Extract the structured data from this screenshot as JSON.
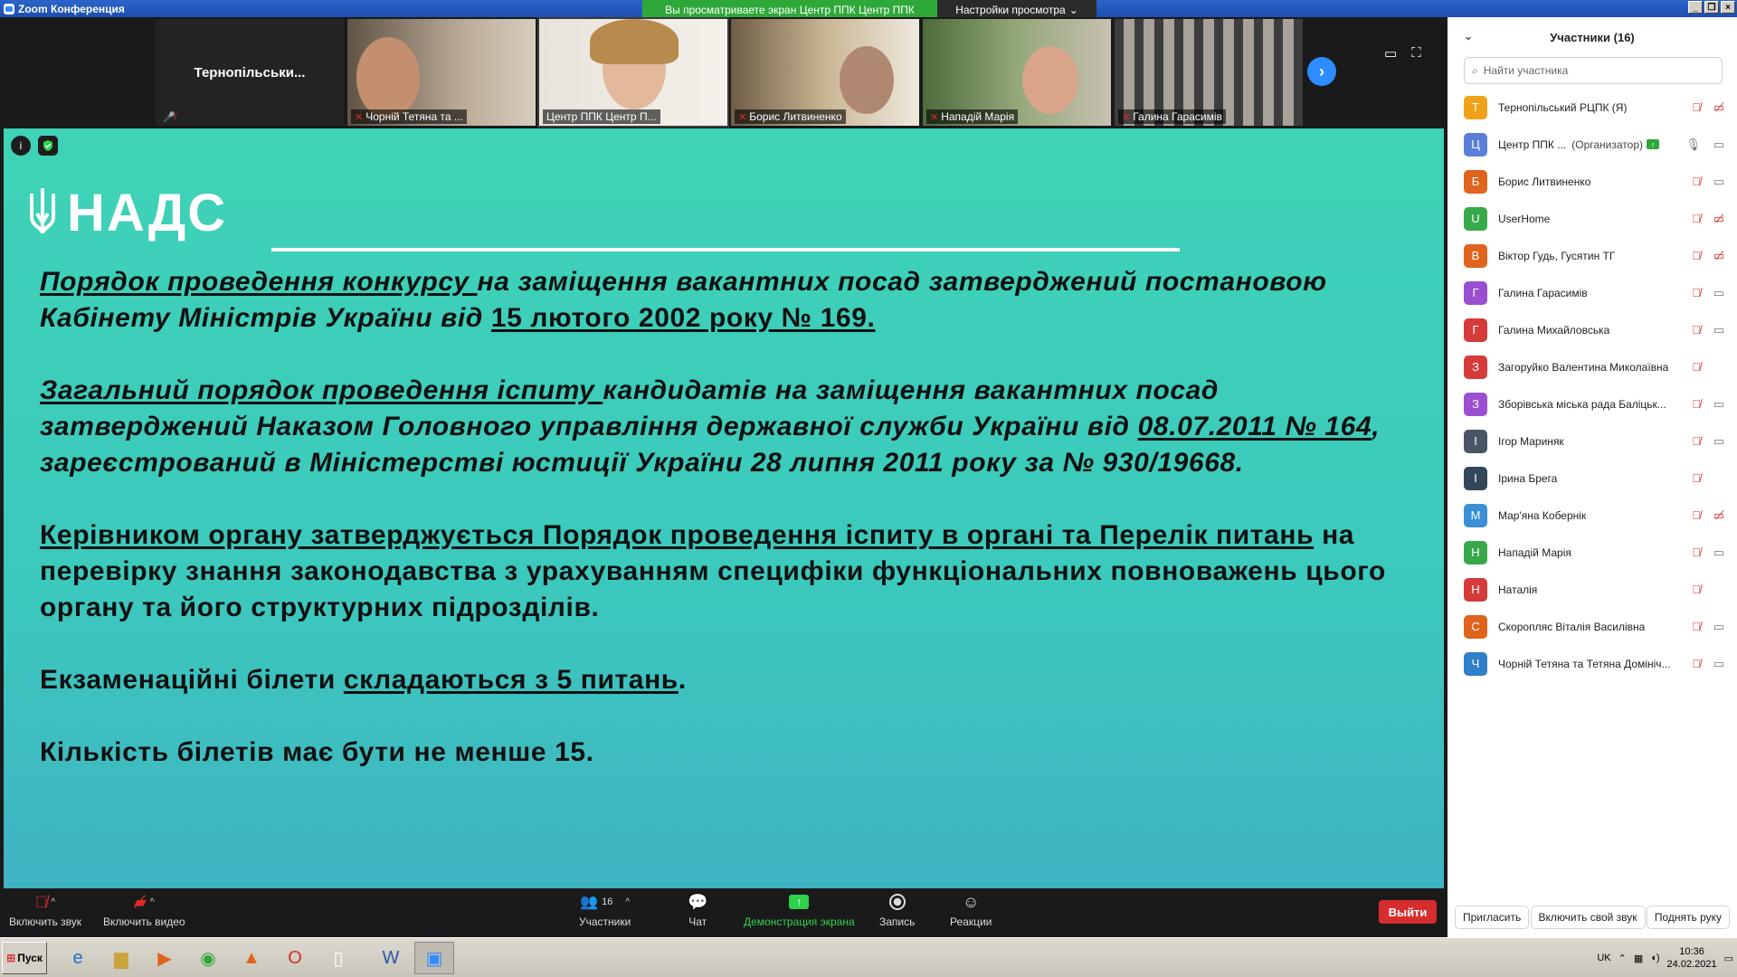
{
  "window": {
    "title": "Zoom Конференция",
    "viewing_banner": "Вы просматриваете экран Центр ППК Центр ППК",
    "view_settings": "Настройки просмотра"
  },
  "tiles": [
    {
      "name": "Тернопільськи..."
    },
    {
      "name": "Чорній Тетяна та ..."
    },
    {
      "name": "Центр ППК Центр П..."
    },
    {
      "name": "Борис Литвиненко"
    },
    {
      "name": "Нападій Марія"
    },
    {
      "name": "Галина Гарасимів"
    }
  ],
  "slide": {
    "logo": "НАДС",
    "p1_u1": "Порядок проведення конкурсу ",
    "p1_t1": "на заміщення вакантних посад затверджений постановою Кабінету Міністрів України від ",
    "p1_u2": "15 лютого 2002 року № 169.",
    "p2_u1": "Загальний порядок проведення іспиту ",
    "p2_t1": "кандидатів на заміщення вакантних посад затверджений Наказом Головного управління державної служби України від ",
    "p2_u2": "08.07.2011 № 164",
    "p2_t2": ", зареєстрований в Міністерстві юстиції України 28 липня 2011 року за № 930/19668.",
    "p3_u1": "Керівником органу затверджується Порядок проведення іспиту в органі та Перелік питань",
    "p3_t1": " на перевірку знання законодавства з урахуванням специфіки функціональних повноважень цього органу та його структурних підрозділів.",
    "p4_t1": "Екзаменаційні білети ",
    "p4_u1": "складаються з 5 питань",
    "p4_t2": ".",
    "p5_t1": "Кількість білетів має бути не менше 15."
  },
  "toolbar": {
    "audio": "Включить звук",
    "video": "Включить видео",
    "participants": "Участники",
    "participants_count": "16",
    "chat": "Чат",
    "share": "Демонстрация экрана",
    "record": "Запись",
    "reactions": "Реакции",
    "leave": "Выйти"
  },
  "panel": {
    "title": "Участники (16)",
    "search_placeholder": "Найти участника",
    "participants": [
      {
        "initial": "Т",
        "color": "#f0a21b",
        "name": "Тернопільський РЦПК (Я)",
        "role": "",
        "mic": "off",
        "cam": "off"
      },
      {
        "initial": "Ц",
        "color": "#5b7fd6",
        "name": "Центр ППК ...",
        "role": "(Организатор)",
        "mic": "on",
        "cam": "on"
      },
      {
        "initial": "Б",
        "color": "#e0641d",
        "name": "Борис Литвиненко",
        "role": "",
        "mic": "off",
        "cam": "on"
      },
      {
        "initial": "U",
        "color": "#38a94a",
        "name": "UserHome",
        "role": "",
        "mic": "off",
        "cam": "off"
      },
      {
        "initial": "В",
        "color": "#e0641d",
        "name": "Віктор Гудь, Гусятин ТГ",
        "role": "",
        "mic": "off",
        "cam": "off"
      },
      {
        "initial": "Г",
        "color": "#9a4fd1",
        "name": "Галина Гарасимів",
        "role": "",
        "mic": "off",
        "cam": "on"
      },
      {
        "initial": "Г",
        "color": "#d63b3b",
        "name": "Галина Михайловська",
        "role": "",
        "mic": "off",
        "cam": "on"
      },
      {
        "initial": "З",
        "color": "#d63b3b",
        "name": "Загоруйко Валентина Миколаївна",
        "role": "",
        "mic": "off",
        "cam": ""
      },
      {
        "initial": "З",
        "color": "#9a4fd1",
        "name": "Зборівська міська рада Баліцьк...",
        "role": "",
        "mic": "off",
        "cam": "on"
      },
      {
        "initial": "І",
        "color": "#4a5565",
        "name": "Ігор Мариняк",
        "role": "",
        "mic": "off",
        "cam": "on"
      },
      {
        "initial": "І",
        "color": "#33475b",
        "name": "Ірина Брега",
        "role": "",
        "mic": "off",
        "cam": ""
      },
      {
        "initial": "М",
        "color": "#3a8fd6",
        "name": "Мар'яна Кобернік",
        "role": "",
        "mic": "off",
        "cam": "off"
      },
      {
        "initial": "Н",
        "color": "#38a94a",
        "name": "Нападій Марія",
        "role": "",
        "mic": "off",
        "cam": "on"
      },
      {
        "initial": "Н",
        "color": "#d63b3b",
        "name": "Наталія",
        "role": "",
        "mic": "off",
        "cam": ""
      },
      {
        "initial": "С",
        "color": "#e0641d",
        "name": "Скоропляс Віталія Василівна",
        "role": "",
        "mic": "off",
        "cam": "on"
      },
      {
        "initial": "Ч",
        "color": "#2f7fc9",
        "name": "Чорній Тетяна та Тетяна Домініч...",
        "role": "",
        "mic": "off",
        "cam": "on"
      }
    ],
    "invite": "Пригласить",
    "unmute_self": "Включить свой звук",
    "raise_hand": "Поднять руку"
  },
  "taskbar": {
    "start": "Пуск",
    "lang": "UK",
    "time": "10:36",
    "date": "24.02.2021"
  }
}
